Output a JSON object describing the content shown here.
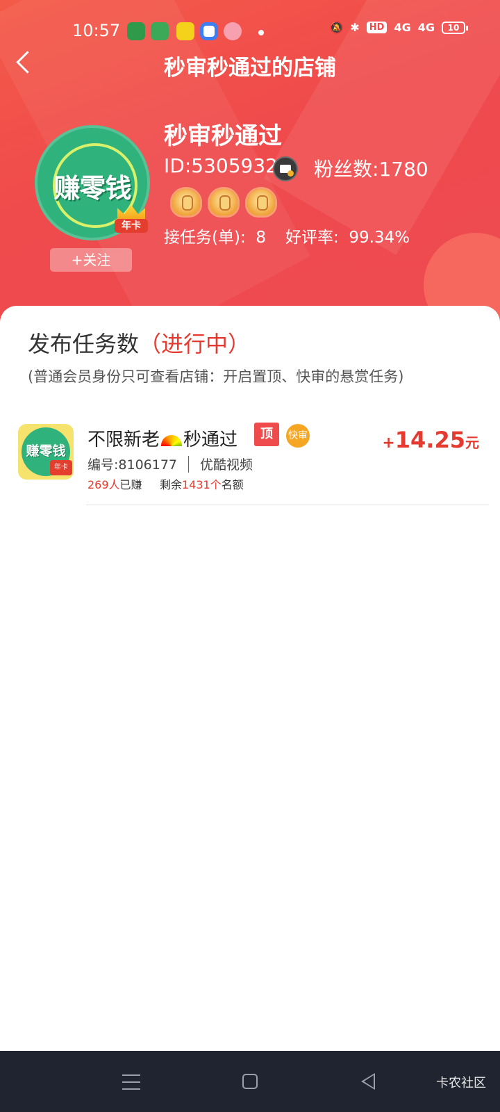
{
  "status_bar": {
    "time": "10:57",
    "hd": "HD",
    "signal_1": "4G",
    "signal_2": "4G",
    "battery": "10"
  },
  "nav": {
    "title": "秒审秒通过的店铺"
  },
  "shop": {
    "logo_text": "赚零钱",
    "vip_badge": "年卡",
    "name": "秒审秒通过",
    "id_text": "ID:5305932",
    "fans_label": "粉丝数:",
    "fans_value": "1780",
    "follow_label": "+关注",
    "stats": {
      "tasks_label": "接任务(单):",
      "tasks_value": "8",
      "rating_label": "好评率:",
      "rating_value": "99.34%"
    },
    "level_crowns": 3
  },
  "section": {
    "title": "发布任务数",
    "status": "（进行中）",
    "note": "(普通会员身份只可查看店铺：开启置顶、快审的悬赏任务)"
  },
  "tasks": [
    {
      "thumb_text": "赚零钱",
      "thumb_badge": "年卡",
      "title_part1": "不限新老",
      "title_part2": "秒通过",
      "badge_top": "顶",
      "badge_fast": "快审",
      "number": "编号:8106177",
      "platform": "优酷视频",
      "earned_count": "269人",
      "earned_label": "已赚",
      "remaining_label": "剩余",
      "remaining_count": "1431个",
      "quota_label": "名额",
      "price_sign": "+",
      "price_amount": "14.25",
      "price_unit": "元"
    }
  ],
  "watermark": "卡农社区",
  "colors": {
    "header_red": "#ef4a4c",
    "accent_red": "#e53a2f",
    "nav_bar": "#1f2430"
  }
}
